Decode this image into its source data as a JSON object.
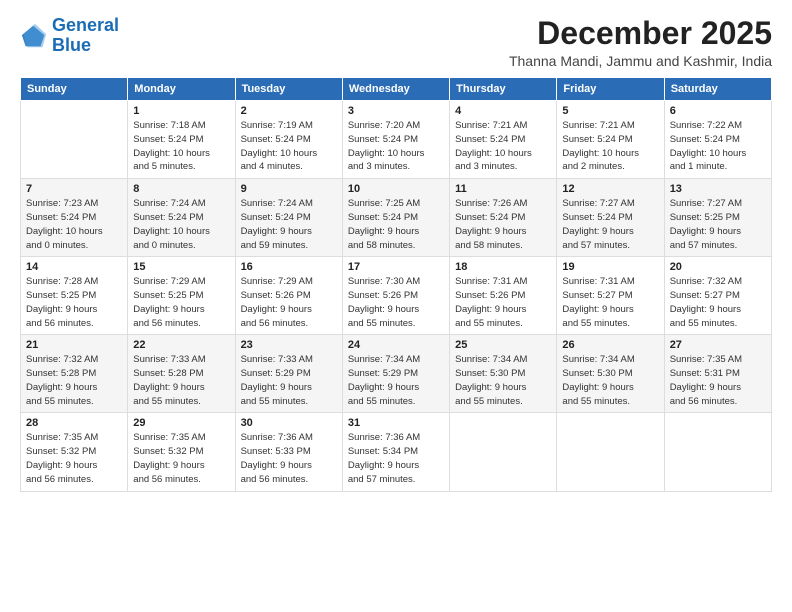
{
  "logo": {
    "line1": "General",
    "line2": "Blue"
  },
  "header": {
    "month_year": "December 2025",
    "location": "Thanna Mandi, Jammu and Kashmir, India"
  },
  "days_of_week": [
    "Sunday",
    "Monday",
    "Tuesday",
    "Wednesday",
    "Thursday",
    "Friday",
    "Saturday"
  ],
  "weeks": [
    {
      "row": 0,
      "cells": [
        {
          "day": null,
          "info": null
        },
        {
          "day": "1",
          "info": "Sunrise: 7:18 AM\nSunset: 5:24 PM\nDaylight: 10 hours\nand 5 minutes."
        },
        {
          "day": "2",
          "info": "Sunrise: 7:19 AM\nSunset: 5:24 PM\nDaylight: 10 hours\nand 4 minutes."
        },
        {
          "day": "3",
          "info": "Sunrise: 7:20 AM\nSunset: 5:24 PM\nDaylight: 10 hours\nand 3 minutes."
        },
        {
          "day": "4",
          "info": "Sunrise: 7:21 AM\nSunset: 5:24 PM\nDaylight: 10 hours\nand 3 minutes."
        },
        {
          "day": "5",
          "info": "Sunrise: 7:21 AM\nSunset: 5:24 PM\nDaylight: 10 hours\nand 2 minutes."
        },
        {
          "day": "6",
          "info": "Sunrise: 7:22 AM\nSunset: 5:24 PM\nDaylight: 10 hours\nand 1 minute."
        }
      ]
    },
    {
      "row": 1,
      "cells": [
        {
          "day": "7",
          "info": "Sunrise: 7:23 AM\nSunset: 5:24 PM\nDaylight: 10 hours\nand 0 minutes."
        },
        {
          "day": "8",
          "info": "Sunrise: 7:24 AM\nSunset: 5:24 PM\nDaylight: 10 hours\nand 0 minutes."
        },
        {
          "day": "9",
          "info": "Sunrise: 7:24 AM\nSunset: 5:24 PM\nDaylight: 9 hours\nand 59 minutes."
        },
        {
          "day": "10",
          "info": "Sunrise: 7:25 AM\nSunset: 5:24 PM\nDaylight: 9 hours\nand 58 minutes."
        },
        {
          "day": "11",
          "info": "Sunrise: 7:26 AM\nSunset: 5:24 PM\nDaylight: 9 hours\nand 58 minutes."
        },
        {
          "day": "12",
          "info": "Sunrise: 7:27 AM\nSunset: 5:24 PM\nDaylight: 9 hours\nand 57 minutes."
        },
        {
          "day": "13",
          "info": "Sunrise: 7:27 AM\nSunset: 5:25 PM\nDaylight: 9 hours\nand 57 minutes."
        }
      ]
    },
    {
      "row": 2,
      "cells": [
        {
          "day": "14",
          "info": "Sunrise: 7:28 AM\nSunset: 5:25 PM\nDaylight: 9 hours\nand 56 minutes."
        },
        {
          "day": "15",
          "info": "Sunrise: 7:29 AM\nSunset: 5:25 PM\nDaylight: 9 hours\nand 56 minutes."
        },
        {
          "day": "16",
          "info": "Sunrise: 7:29 AM\nSunset: 5:26 PM\nDaylight: 9 hours\nand 56 minutes."
        },
        {
          "day": "17",
          "info": "Sunrise: 7:30 AM\nSunset: 5:26 PM\nDaylight: 9 hours\nand 55 minutes."
        },
        {
          "day": "18",
          "info": "Sunrise: 7:31 AM\nSunset: 5:26 PM\nDaylight: 9 hours\nand 55 minutes."
        },
        {
          "day": "19",
          "info": "Sunrise: 7:31 AM\nSunset: 5:27 PM\nDaylight: 9 hours\nand 55 minutes."
        },
        {
          "day": "20",
          "info": "Sunrise: 7:32 AM\nSunset: 5:27 PM\nDaylight: 9 hours\nand 55 minutes."
        }
      ]
    },
    {
      "row": 3,
      "cells": [
        {
          "day": "21",
          "info": "Sunrise: 7:32 AM\nSunset: 5:28 PM\nDaylight: 9 hours\nand 55 minutes."
        },
        {
          "day": "22",
          "info": "Sunrise: 7:33 AM\nSunset: 5:28 PM\nDaylight: 9 hours\nand 55 minutes."
        },
        {
          "day": "23",
          "info": "Sunrise: 7:33 AM\nSunset: 5:29 PM\nDaylight: 9 hours\nand 55 minutes."
        },
        {
          "day": "24",
          "info": "Sunrise: 7:34 AM\nSunset: 5:29 PM\nDaylight: 9 hours\nand 55 minutes."
        },
        {
          "day": "25",
          "info": "Sunrise: 7:34 AM\nSunset: 5:30 PM\nDaylight: 9 hours\nand 55 minutes."
        },
        {
          "day": "26",
          "info": "Sunrise: 7:34 AM\nSunset: 5:30 PM\nDaylight: 9 hours\nand 55 minutes."
        },
        {
          "day": "27",
          "info": "Sunrise: 7:35 AM\nSunset: 5:31 PM\nDaylight: 9 hours\nand 56 minutes."
        }
      ]
    },
    {
      "row": 4,
      "cells": [
        {
          "day": "28",
          "info": "Sunrise: 7:35 AM\nSunset: 5:32 PM\nDaylight: 9 hours\nand 56 minutes."
        },
        {
          "day": "29",
          "info": "Sunrise: 7:35 AM\nSunset: 5:32 PM\nDaylight: 9 hours\nand 56 minutes."
        },
        {
          "day": "30",
          "info": "Sunrise: 7:36 AM\nSunset: 5:33 PM\nDaylight: 9 hours\nand 56 minutes."
        },
        {
          "day": "31",
          "info": "Sunrise: 7:36 AM\nSunset: 5:34 PM\nDaylight: 9 hours\nand 57 minutes."
        },
        {
          "day": null,
          "info": null
        },
        {
          "day": null,
          "info": null
        },
        {
          "day": null,
          "info": null
        }
      ]
    }
  ]
}
